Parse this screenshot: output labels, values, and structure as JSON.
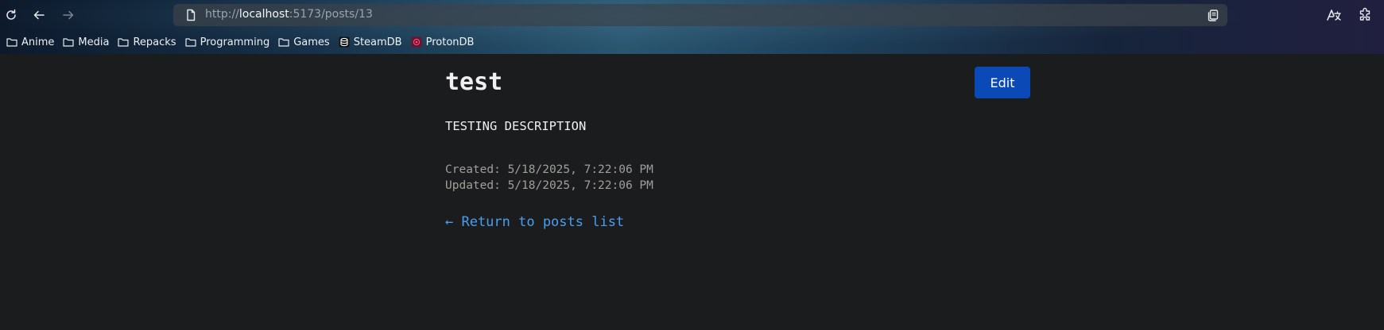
{
  "browser": {
    "url": {
      "scheme": "http://",
      "host": "localhost",
      "rest": ":5173/posts/13"
    },
    "bookmarks": [
      {
        "label": "Anime",
        "icon": "folder-icon"
      },
      {
        "label": "Media",
        "icon": "folder-icon"
      },
      {
        "label": "Repacks",
        "icon": "folder-icon"
      },
      {
        "label": "Programming",
        "icon": "folder-icon"
      },
      {
        "label": "Games",
        "icon": "folder-icon"
      },
      {
        "label": "SteamDB",
        "icon": "steamdb-icon"
      },
      {
        "label": "ProtonDB",
        "icon": "protondb-icon"
      }
    ]
  },
  "post": {
    "title": "test",
    "edit_label": "Edit",
    "description": "TESTING DESCRIPTION",
    "created": "Created: 5/18/2025, 7:22:06 PM",
    "updated": "Updated: 5/18/2025, 7:22:06 PM",
    "return_label": "← Return to posts list"
  },
  "colors": {
    "page_background": "#1b1c1e",
    "accent_button": "#0a49b6",
    "link": "#4a9ef0",
    "meta_text": "#a19f9a"
  }
}
